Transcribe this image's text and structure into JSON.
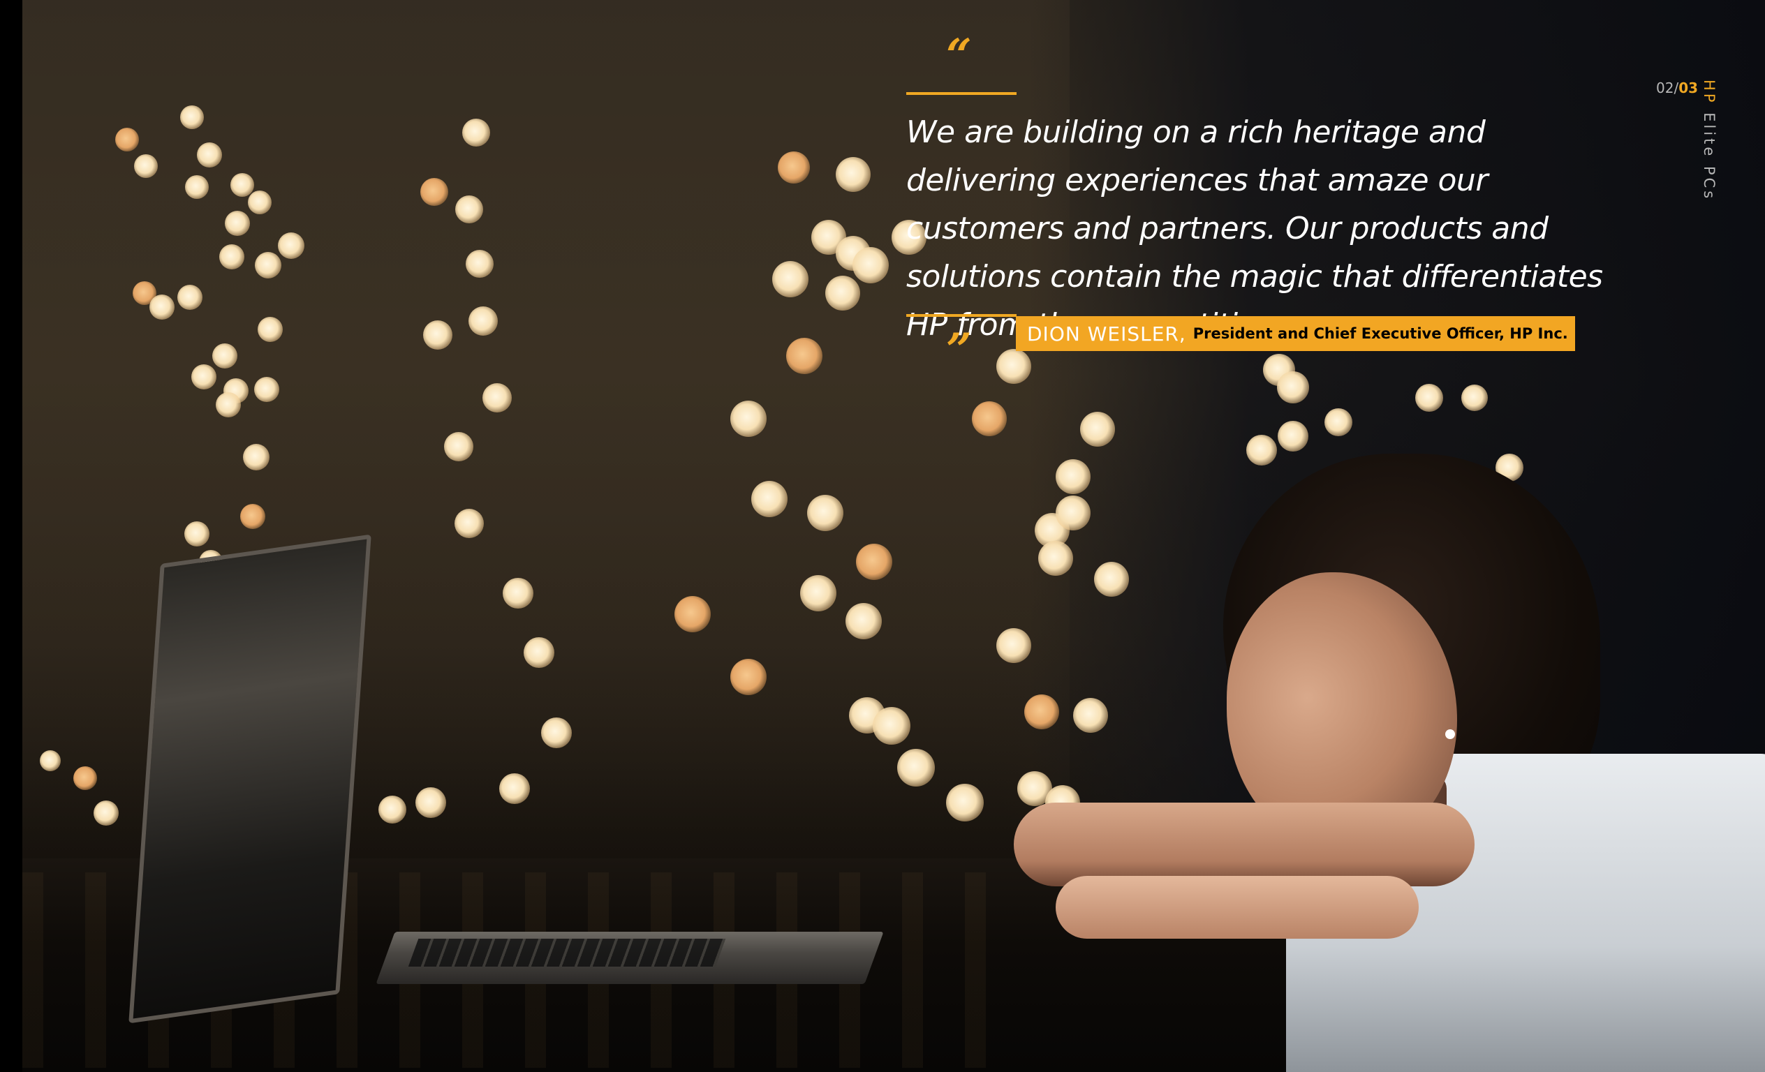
{
  "quote": {
    "open_mark": "“",
    "close_mark": "”",
    "text": "We are building on a rich heritage and delivering experiences that amaze our customers and partners. Our products and solutions contain the magic that differentiates HP from the competition."
  },
  "attribution": {
    "name": "DION WEISLER,",
    "title": "President and Chief Executive Officer, HP Inc."
  },
  "page_indicator": {
    "current": "02/",
    "total": "03"
  },
  "running_title": {
    "brand": "HP",
    "rest": " Elite PCs"
  },
  "colors": {
    "accent": "#f0a823",
    "label_bg": "#f2a623",
    "text": "#ffffff",
    "muted": "#b7b7b7"
  },
  "photo": {
    "description_icon": "photo-laptop-woman-bokeh"
  }
}
